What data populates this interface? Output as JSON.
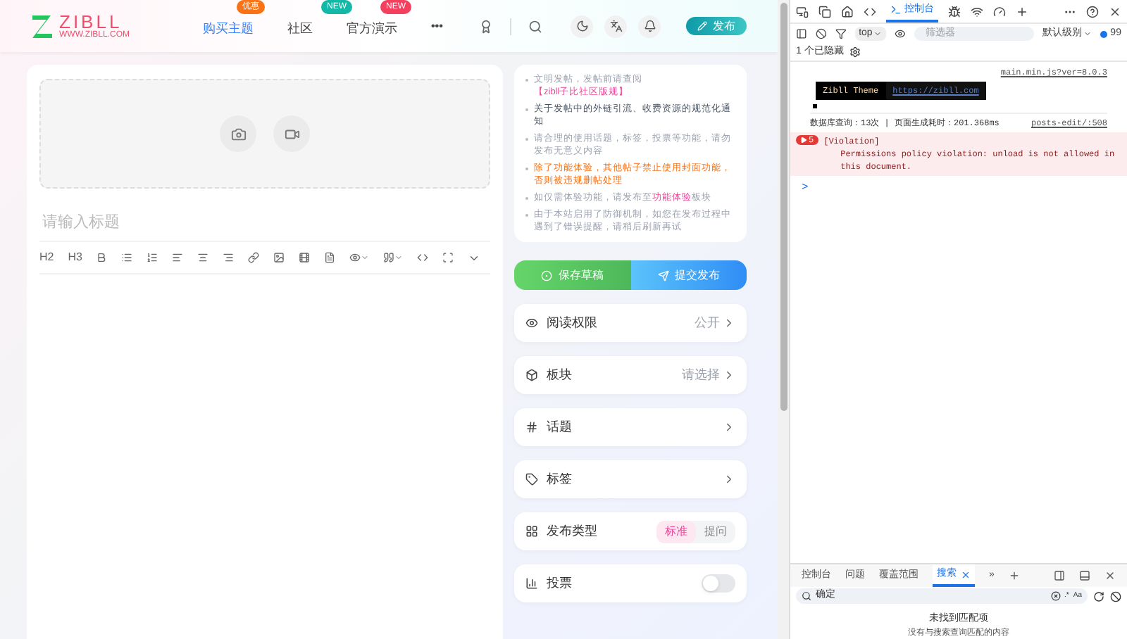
{
  "header": {
    "logo": "ZIBLL",
    "logo_sub": "WWW.ZIBLL.COM",
    "nav": [
      {
        "label": "购买主题",
        "selected": true,
        "badge": "优惠",
        "color": "#f97316"
      },
      {
        "label": "社区",
        "selected": false,
        "badge": "NEW",
        "color": "#14b8a6"
      },
      {
        "label": "官方演示",
        "selected": false,
        "badge": "NEW",
        "color": "#f43f5e"
      }
    ],
    "more": "•••",
    "publish": "发布"
  },
  "editor": {
    "title_placeholder": "请输入标题",
    "toolbar_text": [
      "H2",
      "H3"
    ]
  },
  "notice": [
    {
      "kind": "muted",
      "text": "文明发帖，发帖前请查阅",
      "link": "【zibll子比社区版规】"
    },
    {
      "kind": "dark",
      "text": "关于发帖中的外链引流、收费资源的规范化通知"
    },
    {
      "kind": "muted",
      "text": "请合理的使用话题，标签，投票等功能，请勿发布无意义内容"
    },
    {
      "kind": "warning",
      "text": "除了功能体验，其他帖子禁止使用封面功能，否则被违规删帖处理"
    },
    {
      "kind": "muted",
      "text": "如仅需体验功能，请发布至",
      "link": "功能体验",
      "after": "板块"
    },
    {
      "kind": "muted",
      "text": "由于本站启用了防御机制，如您在发布过程中遇到了错误提醒，请稍后刷新再试"
    }
  ],
  "actions": {
    "save": "保存草稿",
    "submit": "提交发布"
  },
  "settings": [
    {
      "kind": "link",
      "label": "阅读权限",
      "value": "公开"
    },
    {
      "kind": "link",
      "label": "板块",
      "value": "请选择"
    },
    {
      "kind": "link",
      "label": "话题"
    },
    {
      "kind": "link",
      "label": "标签"
    },
    {
      "kind": "segmented",
      "label": "发布类型",
      "options": [
        {
          "label": "标准",
          "selected": true
        },
        {
          "label": "提问",
          "selected": false
        }
      ]
    },
    {
      "kind": "toggle",
      "label": "投票",
      "on": false
    }
  ],
  "devtools": {
    "tabs": [
      {
        "label": "控制台",
        "selected": true
      }
    ],
    "context": "top",
    "filter_placeholder": "筛选器",
    "level": "默认级别",
    "issues": "99",
    "hidden": "1 个已隐藏",
    "console": {
      "source": "main.min.js?ver=8.0.3",
      "badge": "Zibll Theme",
      "badge_link": "https://zibll.com",
      "stats": "数据库查询：13次 | 页面生成耗时：201.368ms",
      "stats_source": "posts-edit/:508",
      "violation_count": "5",
      "violation_title": "[Violation]",
      "violation_text": "Permissions policy violation: unload is not allowed in this document.",
      "prompt": ">"
    },
    "drawer_tabs": [
      {
        "label": "控制台",
        "selected": false
      },
      {
        "label": "问题",
        "selected": false
      },
      {
        "label": "覆盖范围",
        "selected": false
      },
      {
        "label": "搜索",
        "selected": true
      }
    ],
    "more": "»",
    "search_value": "确定",
    "regex": ".*",
    "case": "Aa",
    "result_title": "未找到匹配项",
    "result_text": "没有与搜索查询匹配的内容"
  }
}
